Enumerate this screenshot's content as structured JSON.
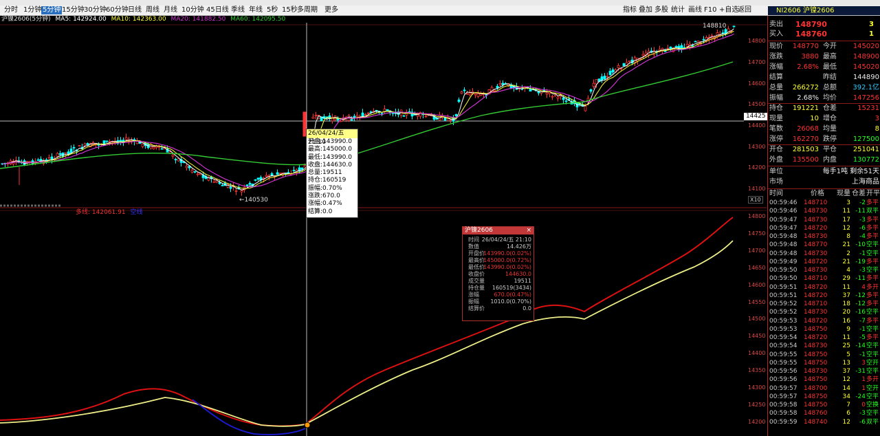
{
  "colors": {
    "up": "#ff3333",
    "down": "#00ffff",
    "bg": "#000000",
    "ma5": "#ffffff",
    "ma10": "#ffff33",
    "ma20": "#cc33cc",
    "ma60": "#33cc33",
    "line_red": "#dd1111",
    "line_yellow": "#eeee88",
    "line_blue": "#1a1acc"
  },
  "toolbar": {
    "periods": [
      "分时",
      "1分钟",
      "5分钟",
      "15分钟",
      "30分钟",
      "60分钟",
      "日线",
      "周线",
      "月线",
      "10分钟",
      "45日线",
      "季线",
      "年线",
      "5秒",
      "15秒",
      "多周期",
      "更多"
    ],
    "selected": "5分钟",
    "right_items": [
      "指标",
      "叠加",
      "多股",
      "统计",
      "画线",
      "F10",
      "+自选",
      "返回"
    ]
  },
  "chart_header": {
    "symbol": "沪镍2606(5分钟)",
    "ma5": "MA5: 142924.00",
    "ma10": "MA10: 142363.00",
    "ma20": "MA20: 141882.50",
    "ma60": "MA60: 142095.50"
  },
  "lower_header": {
    "label": "多线: 142061.91",
    "extra": "空线"
  },
  "annotations": {
    "high": "148810",
    "low": "140530",
    "cross_y": "14425"
  },
  "tooltip": {
    "date": "26/04/24/五 21:10",
    "rows": [
      "开盘:143990.0",
      "最高:145000.0",
      "最低:143990.0",
      "收盘:144630.0",
      "总量:19511",
      "持仓:160519",
      "振幅:0.70%",
      "涨跌:670.0",
      "涨幅:0.47%",
      "结算:0.0"
    ]
  },
  "detail": {
    "title": "沪镍2606",
    "close": "×",
    "rows": [
      {
        "k": "时间",
        "v": "26/04/24/五  21:10",
        "c": ""
      },
      {
        "k": "数值",
        "v": "14.426万",
        "c": ""
      },
      {
        "k": "开盘价",
        "v": "143990.0(0.02%)",
        "c": "red"
      },
      {
        "k": "最高价",
        "v": "145000.0(0.72%)",
        "c": "red"
      },
      {
        "k": "最低价",
        "v": "143990.0(0.02%)",
        "c": "red"
      },
      {
        "k": "收盘价",
        "v": "144630.0",
        "c": "red"
      },
      {
        "k": "成交量",
        "v": "19511",
        "c": ""
      },
      {
        "k": "持仓量",
        "v": "160519(3434)",
        "c": ""
      },
      {
        "k": "涨幅",
        "v": "670.0(0.47%)",
        "c": "red"
      },
      {
        "k": "振幅",
        "v": "1010.0(0.70%)",
        "c": ""
      },
      {
        "k": "结算价",
        "v": "0.0",
        "c": ""
      }
    ]
  },
  "y_axis_upper": [
    "14800",
    "14700",
    "14600",
    "14500",
    "14400",
    "14300",
    "14200",
    "14100"
  ],
  "y_axis_scale": "X10",
  "y_axis_lower": [
    "14800",
    "14750",
    "14700",
    "14650",
    "14600",
    "14550",
    "14500",
    "14450",
    "14400",
    "14350",
    "14300",
    "14250",
    "14200"
  ],
  "panel": {
    "title": "NI2606 沪镍2606",
    "sell": {
      "label": "卖出",
      "price": "148790",
      "vol": "3"
    },
    "buy": {
      "label": "买入",
      "price": "148760",
      "vol": "1"
    },
    "quotes": [
      [
        "现价",
        "148770",
        "今开",
        "145020"
      ],
      [
        "涨跌",
        "3880",
        "最高",
        "148900"
      ],
      [
        "涨幅",
        "2.68%",
        "最低",
        "145020"
      ],
      [
        "结算",
        "",
        "昨结",
        "144890"
      ],
      [
        "总量",
        "266272",
        "总额",
        "392.1亿"
      ],
      [
        "振幅",
        "2.68%",
        "均价",
        "147256"
      ]
    ],
    "quotes2": [
      [
        "持仓",
        "191221",
        "仓差",
        "15231"
      ],
      [
        "现量",
        "10",
        "增仓",
        "3"
      ],
      [
        "笔数",
        "26068",
        "均量",
        "8"
      ],
      [
        "涨停",
        "162270",
        "跌停",
        "127500"
      ]
    ],
    "quotes3": [
      [
        "开仓",
        "281503",
        "平仓",
        "251041"
      ],
      [
        "外盘",
        "135500",
        "内盘",
        "130772"
      ]
    ],
    "unit": {
      "label": "单位",
      "value": "每手1吨  剩余51天"
    },
    "market": {
      "label": "市场",
      "value": "上海商品"
    },
    "tick_headers": [
      "时间",
      "价格",
      "现量",
      "仓差",
      "开平"
    ],
    "ticks": [
      [
        "00:59:46",
        "148710",
        "3",
        "-2",
        "多平"
      ],
      [
        "00:59:46",
        "148730",
        "11",
        "-11",
        "双平"
      ],
      [
        "00:59:47",
        "148730",
        "17",
        "-3",
        "多平"
      ],
      [
        "00:59:47",
        "148720",
        "12",
        "-6",
        "多平"
      ],
      [
        "00:59:48",
        "148730",
        "8",
        "-4",
        "多平"
      ],
      [
        "00:59:48",
        "148770",
        "21",
        "-10",
        "空平"
      ],
      [
        "00:59:48",
        "148730",
        "2",
        "-1",
        "空平"
      ],
      [
        "00:59:49",
        "148720",
        "21",
        "-19",
        "多平"
      ],
      [
        "00:59:50",
        "148730",
        "4",
        "-3",
        "空平"
      ],
      [
        "00:59:50",
        "148710",
        "29",
        "-11",
        "多平"
      ],
      [
        "00:59:51",
        "148720",
        "11",
        "4",
        "多开"
      ],
      [
        "00:59:51",
        "148720",
        "37",
        "-12",
        "多平"
      ],
      [
        "00:59:52",
        "148710",
        "18",
        "-12",
        "多平"
      ],
      [
        "00:59:52",
        "148730",
        "20",
        "-16",
        "空平"
      ],
      [
        "00:59:53",
        "148720",
        "16",
        "-7",
        "多平"
      ],
      [
        "00:59:53",
        "148750",
        "9",
        "-1",
        "空平"
      ],
      [
        "00:59:54",
        "148720",
        "11",
        "-5",
        "多平"
      ],
      [
        "00:59:54",
        "148730",
        "25",
        "-14",
        "空平"
      ],
      [
        "00:59:55",
        "148750",
        "5",
        "-1",
        "空平"
      ],
      [
        "00:59:55",
        "148750",
        "13",
        "3",
        "空开"
      ],
      [
        "00:59:56",
        "148730",
        "37",
        "-31",
        "空平"
      ],
      [
        "00:59:56",
        "148750",
        "12",
        "1",
        "多开"
      ],
      [
        "00:59:57",
        "148700",
        "14",
        "1",
        "空开"
      ],
      [
        "00:59:57",
        "148750",
        "34",
        "-24",
        "空平"
      ],
      [
        "00:59:58",
        "148750",
        "7",
        "0",
        "空换"
      ],
      [
        "00:59:58",
        "148760",
        "6",
        "-3",
        "空平"
      ],
      [
        "00:59:59",
        "148740",
        "12",
        "-6",
        "双平"
      ]
    ]
  }
}
